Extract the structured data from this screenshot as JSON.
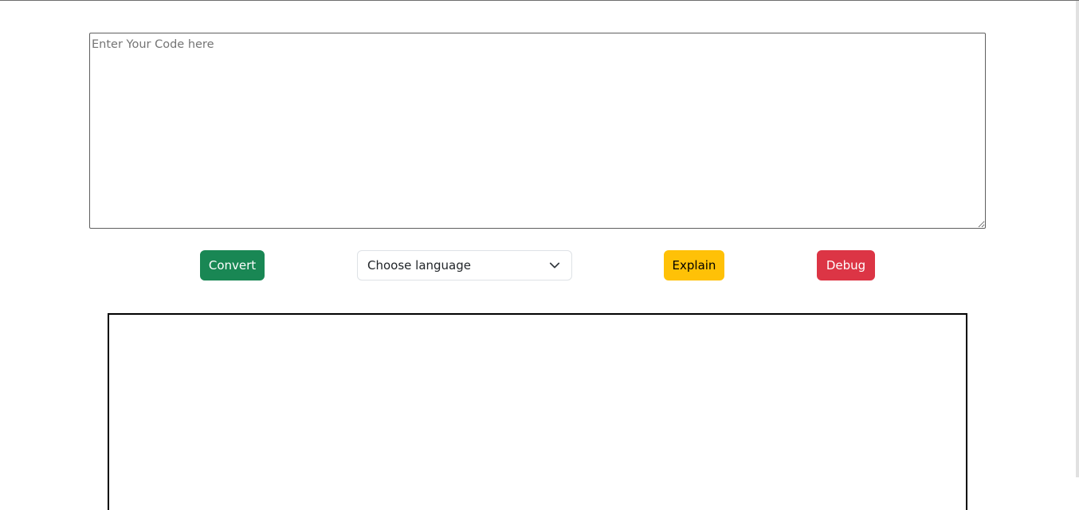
{
  "code_input": {
    "placeholder": "Enter Your Code here",
    "value": ""
  },
  "actions": {
    "convert_label": "Convert",
    "explain_label": "Explain",
    "debug_label": "Debug"
  },
  "language_select": {
    "selected": "Choose language",
    "icon": "chevron-down-icon"
  },
  "output": {
    "text": ""
  },
  "colors": {
    "convert": "#198754",
    "explain": "#ffc107",
    "debug": "#dc3545"
  }
}
